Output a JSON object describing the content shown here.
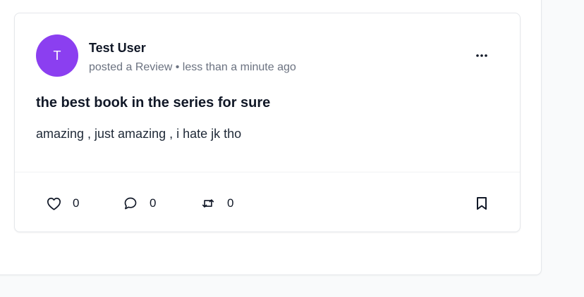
{
  "post": {
    "avatar_initial": "T",
    "avatar_color": "#8b3ff0",
    "user_name": "Test User",
    "meta": "posted a Review • less than a minute ago",
    "title": "the best book in the series for sure",
    "body": "amazing , just amazing , i hate jk tho",
    "more_icon": "ellipsis-horizontal-icon"
  },
  "actions": {
    "likes": {
      "icon": "heart-icon",
      "count": "0"
    },
    "comments": {
      "icon": "comment-bubble-icon",
      "count": "0"
    },
    "reposts": {
      "icon": "repost-icon",
      "count": "0"
    },
    "bookmark": {
      "icon": "bookmark-icon"
    }
  }
}
